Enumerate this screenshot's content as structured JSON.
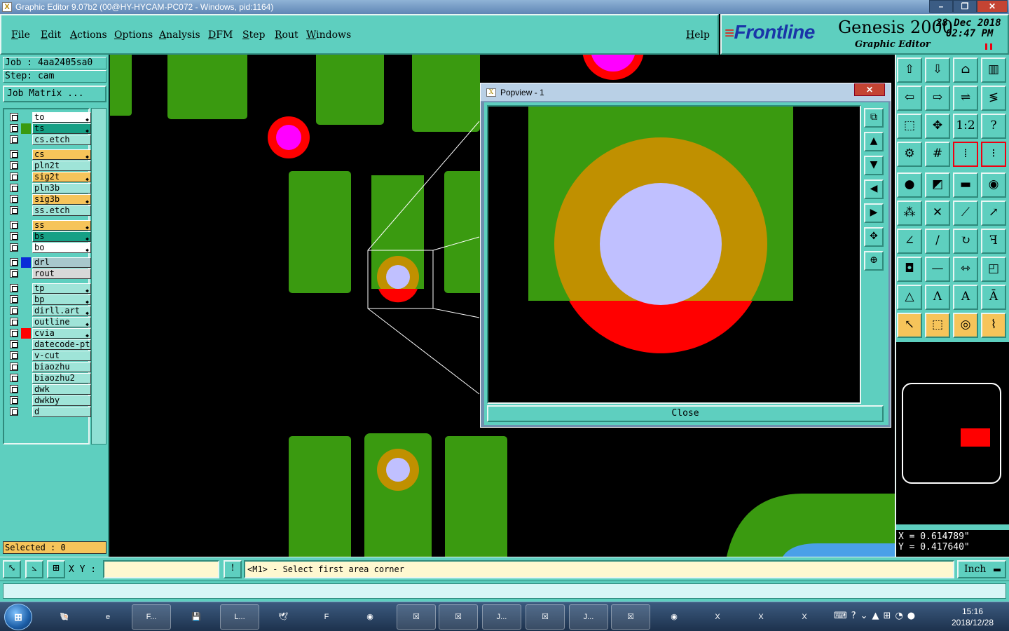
{
  "window": {
    "title": "Graphic Editor 9.07b2 (00@HY-HYCAM-PC072 - Windows, pid:1164)"
  },
  "menu": {
    "items": [
      "File",
      "Edit",
      "Actions",
      "Options",
      "Analysis",
      "DFM",
      "Step",
      "Rout",
      "Windows"
    ],
    "help": "Help"
  },
  "brand": {
    "logo": "Frontline",
    "product": "Genesis 2000",
    "subtitle": "Graphic Editor",
    "date": "28 Dec 2018",
    "time": "02:47 PM"
  },
  "job": {
    "job": "Job : 4aa2405sa0",
    "step": "Step: cam",
    "matrix_button": "Job Matrix ..."
  },
  "layers": [
    {
      "name": "to",
      "bg": "#ffffff",
      "color": "",
      "dot": true
    },
    {
      "name": "ts",
      "bg": "#16a085",
      "color": "#3a9a10",
      "dot": true
    },
    {
      "name": "cs.etch",
      "bg": "#9fe4d8",
      "color": "",
      "dot": false
    },
    {
      "name": "cs",
      "bg": "#f6c45a",
      "color": "",
      "dot": true
    },
    {
      "name": "pln2t",
      "bg": "#9fe4d8",
      "color": "",
      "dot": false
    },
    {
      "name": "sig2t",
      "bg": "#f6c45a",
      "color": "",
      "dot": true
    },
    {
      "name": "pln3b",
      "bg": "#9fe4d8",
      "color": "",
      "dot": false
    },
    {
      "name": "sig3b",
      "bg": "#f6c45a",
      "color": "",
      "dot": true
    },
    {
      "name": "ss.etch",
      "bg": "#9fe4d8",
      "color": "",
      "dot": false
    },
    {
      "name": "ss",
      "bg": "#f6c45a",
      "color": "",
      "dot": true
    },
    {
      "name": "bs",
      "bg": "#16a085",
      "color": "",
      "dot": true
    },
    {
      "name": "bo",
      "bg": "#ffffff",
      "color": "",
      "dot": true
    },
    {
      "name": "drl",
      "bg": "#a8c8cc",
      "color": "#0a2bd8",
      "dot": false
    },
    {
      "name": "rout",
      "bg": "#d8d8d8",
      "color": "",
      "dot": false
    },
    {
      "name": "tp",
      "bg": "#9fe4d8",
      "color": "",
      "dot": true
    },
    {
      "name": "bp",
      "bg": "#9fe4d8",
      "color": "",
      "dot": true
    },
    {
      "name": "dirll.art",
      "bg": "#9fe4d8",
      "color": "",
      "dot": true
    },
    {
      "name": "outline",
      "bg": "#9fe4d8",
      "color": "",
      "dot": true
    },
    {
      "name": "cvia",
      "bg": "#9fe4d8",
      "color": "#ff0000",
      "dot": true
    },
    {
      "name": "datecode-pto",
      "bg": "#9fe4d8",
      "color": "",
      "dot": false
    },
    {
      "name": "v-cut",
      "bg": "#9fe4d8",
      "color": "",
      "dot": false
    },
    {
      "name": "biaozhu",
      "bg": "#9fe4d8",
      "color": "",
      "dot": false
    },
    {
      "name": "biaozhu2",
      "bg": "#9fe4d8",
      "color": "",
      "dot": false
    },
    {
      "name": "dwk",
      "bg": "#9fe4d8",
      "color": "",
      "dot": false
    },
    {
      "name": "dwkby",
      "bg": "#9fe4d8",
      "color": "",
      "dot": false
    },
    {
      "name": "d",
      "bg": "#9fe4d8",
      "color": "",
      "dot": false
    }
  ],
  "selected": "Selected : 0",
  "popview": {
    "title": "Popview - 1",
    "close_button": "Close"
  },
  "coords": {
    "x": "X = 0.614789\"",
    "y": "Y = 0.417640\""
  },
  "status": {
    "xy_label": "X Y :",
    "message": "<M1> - Select first area corner",
    "unit": "Inch"
  },
  "taskbar": {
    "tasks": [
      "F...",
      "L...",
      "J...",
      "J..."
    ],
    "clock_time": "15:16",
    "clock_date": "2018/12/28"
  },
  "colors": {
    "panel": "#5ecfbf",
    "copper_green": "#3a9a10",
    "pad_orange": "#c09000",
    "hole_lavender": "#c0c0ff",
    "via_red": "#ff0000",
    "via_magenta": "#ff00ff"
  }
}
